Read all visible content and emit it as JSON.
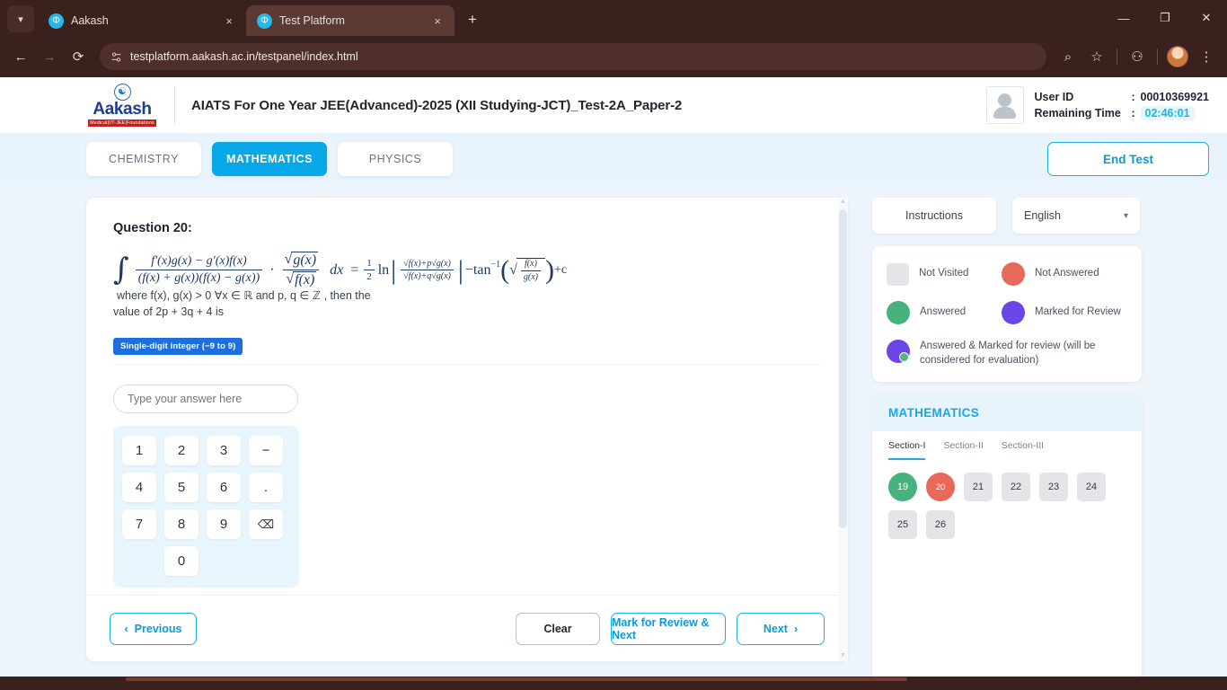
{
  "browser": {
    "tablist_icon": "chevron-down-icon",
    "tabs": [
      {
        "title": "Aakash",
        "favicon": "aakash-favicon",
        "close": "×"
      },
      {
        "title": "Test Platform",
        "favicon": "aakash-favicon",
        "close": "×"
      }
    ],
    "new_tab": "+",
    "window_controls": {
      "minimize": "—",
      "maximize": "❐",
      "close": "✕"
    },
    "nav": {
      "back": "←",
      "forward": "→",
      "reload": "⟳"
    },
    "url": "testplatform.aakash.ac.in/testpanel/index.html",
    "site_icon": "site-settings-icon",
    "toolbar_right": {
      "search": "⌕",
      "bookmark": "☆",
      "extensions": "⚇",
      "menu": "⋮"
    }
  },
  "header": {
    "logo": {
      "mark": "ॐ",
      "name": "Aakash",
      "tagline": "Medical|IIT-JEE|Foundations"
    },
    "title": "AIATS For One Year JEE(Advanced)-2025 (XII Studying-JCT)_Test-2A_Paper-2",
    "user_id_label": "User ID",
    "user_id_value": "00010369921",
    "remaining_time_label": "Remaining Time",
    "remaining_time_value": "02:46:01",
    "colon": ":"
  },
  "subjects": {
    "tabs": [
      {
        "label": "CHEMISTRY",
        "active": false
      },
      {
        "label": "MATHEMATICS",
        "active": true
      },
      {
        "label": "PHYSICS",
        "active": false
      }
    ],
    "end_test": "End Test"
  },
  "question": {
    "number_label": "Question 20:",
    "formula": {
      "integral": "∫",
      "numerator_1": "f′(x)g(x) − g′(x)f(x)",
      "denominator_1": "(f(x) + g(x))(f(x) − g(x))",
      "dot": "·",
      "num_sqrt_g": "g(x)",
      "den_sqrt_f": "f(x)",
      "dx": "dx",
      "equals": "=",
      "half_num": "1",
      "half_den": "2",
      "ln": "ln",
      "ratio_num": "√f(x)+p√g(x)",
      "ratio_den": "√f(x)+q√g(x)",
      "minus_arctan": "−tan",
      "arctan_power": "−1",
      "inner_num": "f(x)",
      "inner_den": "g(x)",
      "plus_c": "+c",
      "tail": "where f(x), g(x) > 0  ∀x ∈ ℝ and p, q ∈ ℤ , then the"
    },
    "text_line2": "value of 2p + 3q + 4 is",
    "answer_type_badge": "Single-digit integer (−9 to 9)",
    "answer_placeholder": "Type your answer here",
    "answer_value": "",
    "keypad": [
      "1",
      "2",
      "3",
      "−",
      "4",
      "5",
      "6",
      ".",
      "7",
      "8",
      "9",
      "⌫",
      "0"
    ],
    "footer": {
      "previous": "Previous",
      "previous_icon": "‹",
      "clear": "Clear",
      "mark_review_next": "Mark for Review & Next",
      "next": "Next",
      "next_icon": "›"
    }
  },
  "rail": {
    "instructions": "Instructions",
    "language_selected": "English",
    "language_caret": "⌄",
    "legend": [
      {
        "label": "Not Visited",
        "shape": "square",
        "color": "#e3e5e8"
      },
      {
        "label": "Not Answered",
        "shape": "circle",
        "color": "#e8685a"
      },
      {
        "label": "Answered",
        "shape": "circle",
        "color": "#46b27e"
      },
      {
        "label": "Marked for Review",
        "shape": "circle",
        "color": "#6a45e8"
      },
      {
        "label": "Answered & Marked for review (will be considered for evaluation)",
        "shape": "circle-dot",
        "color": "#6a45e8"
      }
    ],
    "palette_title": "MATHEMATICS",
    "sections": [
      {
        "label": "Section-I",
        "active": true
      },
      {
        "label": "Section-II",
        "active": false
      },
      {
        "label": "Section-III",
        "active": false
      }
    ],
    "questions": [
      {
        "num": "19",
        "state": "answered"
      },
      {
        "num": "20",
        "state": "notanswered"
      },
      {
        "num": "21",
        "state": "notvisited"
      },
      {
        "num": "22",
        "state": "notvisited"
      },
      {
        "num": "23",
        "state": "notvisited"
      },
      {
        "num": "24",
        "state": "notvisited"
      },
      {
        "num": "25",
        "state": "notvisited"
      },
      {
        "num": "26",
        "state": "notvisited"
      }
    ]
  },
  "colors": {
    "accent": "#07a7e8",
    "answered": "#46b27e",
    "not_answered": "#e8685a",
    "marked": "#6a45e8",
    "not_visited": "#e3e5e8",
    "chrome": "#3a211d"
  }
}
